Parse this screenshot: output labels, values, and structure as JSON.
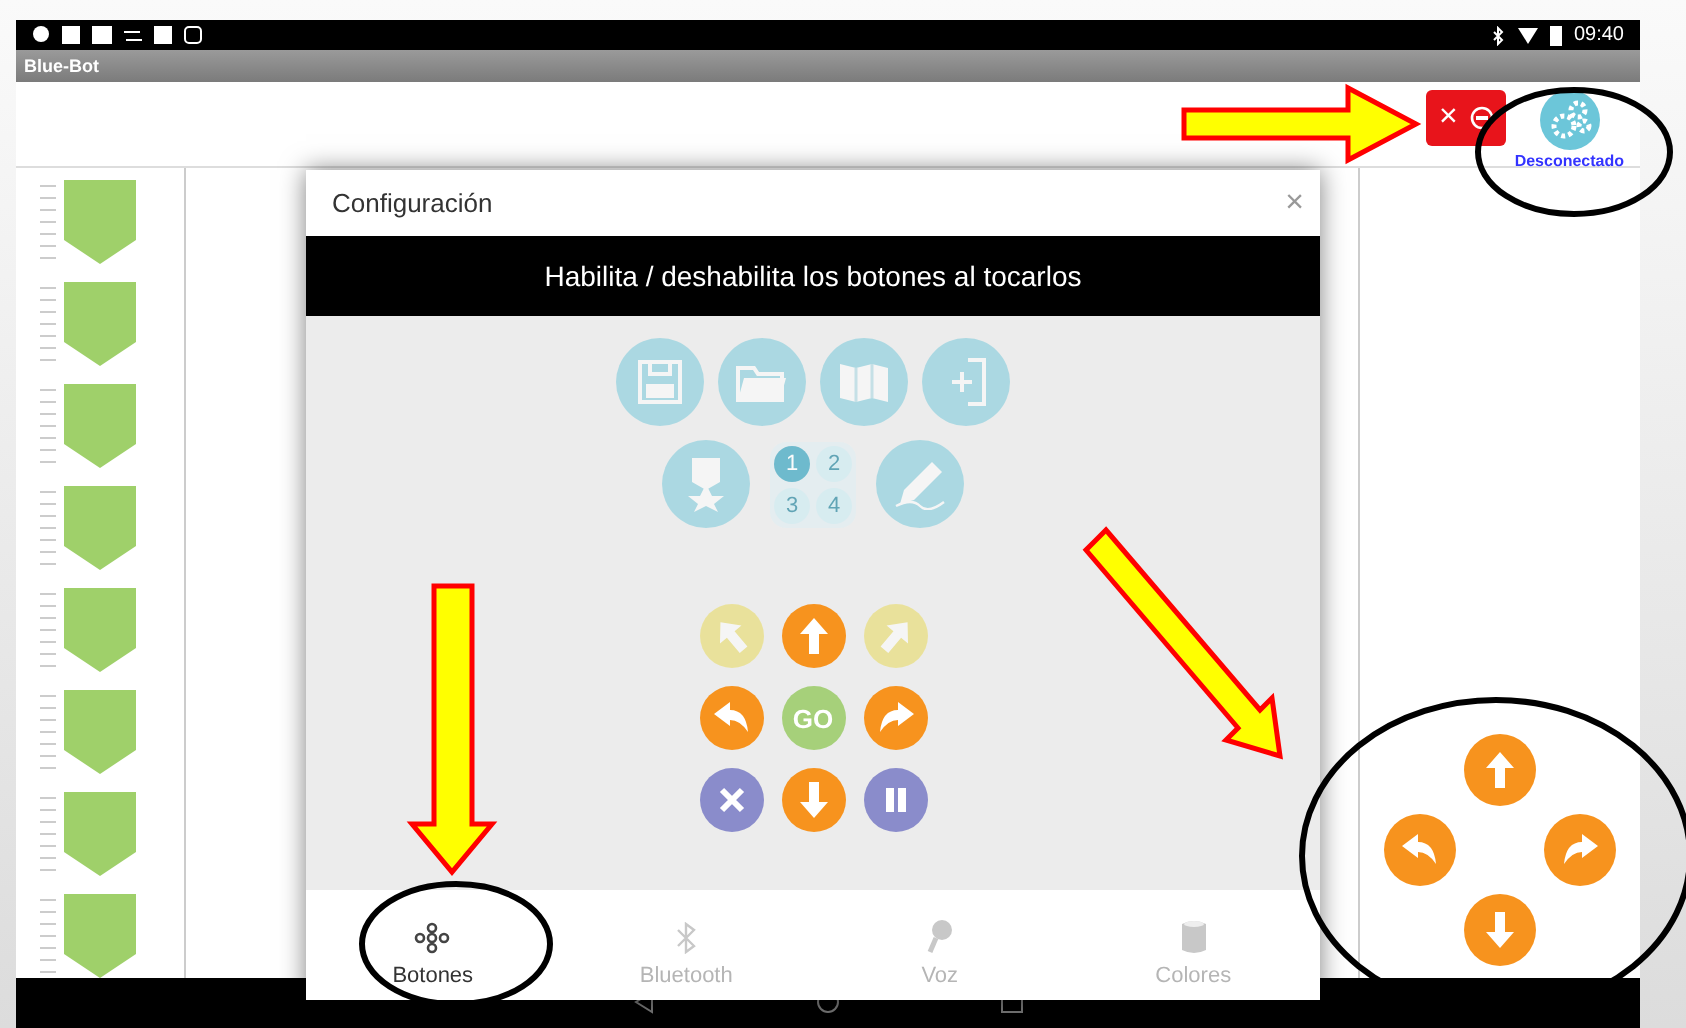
{
  "status_bar": {
    "time": "09:40"
  },
  "app_title": "Blue-Bot",
  "toolbar": {
    "close": "×",
    "connection_status": "Desconectado"
  },
  "dialog": {
    "title": "Configuración",
    "close": "×",
    "banner": "Habilita / deshabilita los botones al tocarlos",
    "tool_buttons": [
      {
        "kind": "save",
        "enabled": false
      },
      {
        "kind": "folder",
        "enabled": false
      },
      {
        "kind": "map",
        "enabled": false
      },
      {
        "kind": "add",
        "enabled": false
      },
      {
        "kind": "badge",
        "enabled": false
      },
      {
        "kind": "slots",
        "enabled": false
      },
      {
        "kind": "pencil",
        "enabled": false
      }
    ],
    "slot_numbers": [
      {
        "label": "1",
        "selected": true
      },
      {
        "label": "2",
        "selected": false
      },
      {
        "label": "3",
        "selected": false
      },
      {
        "label": "4",
        "selected": false
      }
    ],
    "move_buttons": [
      {
        "kind": "up-left",
        "enabled": false
      },
      {
        "kind": "up",
        "enabled": true
      },
      {
        "kind": "up-right",
        "enabled": false
      },
      {
        "kind": "left",
        "enabled": true
      },
      {
        "kind": "go",
        "label": "GO",
        "enabled": true
      },
      {
        "kind": "right",
        "enabled": true
      },
      {
        "kind": "cancel",
        "enabled": true
      },
      {
        "kind": "down",
        "enabled": true
      },
      {
        "kind": "pause",
        "enabled": true
      }
    ],
    "tabs": [
      {
        "kind": "buttons",
        "label": "Botones",
        "selected": true
      },
      {
        "kind": "bluetooth",
        "label": "Bluetooth",
        "selected": false
      },
      {
        "kind": "voice",
        "label": "Voz",
        "selected": false
      },
      {
        "kind": "colors",
        "label": "Colores",
        "selected": false
      }
    ]
  },
  "pad_buttons": [
    {
      "kind": "up"
    },
    {
      "kind": "left"
    },
    {
      "kind": "right"
    },
    {
      "kind": "down"
    }
  ]
}
